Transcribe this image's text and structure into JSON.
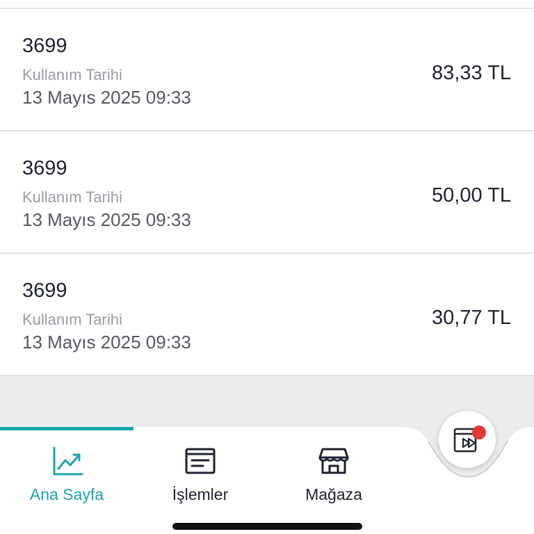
{
  "transactions": [
    {
      "code": "3699",
      "label": "Kullanım Tarihi",
      "date": "13 Mayıs 2025 09:33",
      "amount": "83,33 TL"
    },
    {
      "code": "3699",
      "label": "Kullanım Tarihi",
      "date": "13 Mayıs 2025 09:33",
      "amount": "50,00 TL"
    },
    {
      "code": "3699",
      "label": "Kullanım Tarihi",
      "date": "13 Mayıs 2025 09:33",
      "amount": "30,77 TL"
    }
  ],
  "tabs": [
    {
      "label": "Ana Sayfa",
      "icon": "chart-icon",
      "active": true
    },
    {
      "label": "İşlemler",
      "icon": "list-icon",
      "active": false
    },
    {
      "label": "Mağaza",
      "icon": "store-icon",
      "active": false
    }
  ],
  "fab": {
    "icon": "play-forward-icon",
    "badge": "notification-dot"
  },
  "colors": {
    "accent": "#19a5a8",
    "badge": "#e53935",
    "text": "#1e2230"
  }
}
